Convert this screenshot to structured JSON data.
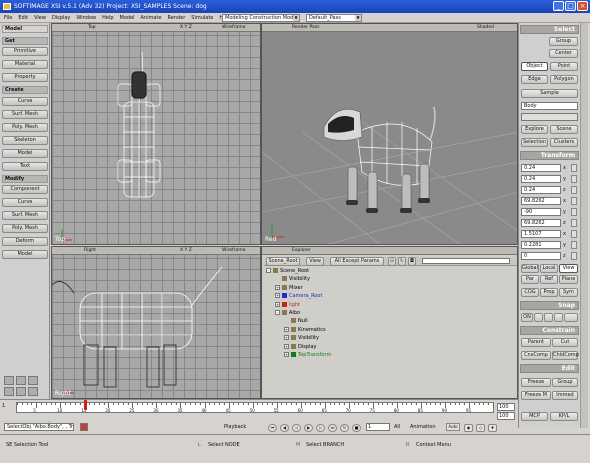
{
  "window": {
    "title": "SOFTIMAGE XSI v.5.1 (Adv 32) Project: XSI_SAMPLES  Scene: dog",
    "buttons": [
      "_",
      "□",
      "×"
    ]
  },
  "menubar": {
    "items": [
      "File",
      "Edit",
      "View",
      "Display",
      "Window",
      "Help",
      "Model",
      "Animate",
      "Render",
      "Simulate",
      "Hair"
    ],
    "mode_combo": "Modeling Construction Mode",
    "pass_combo": "Default_Pass"
  },
  "left_panel": {
    "model_label": "Model",
    "get_header": "Get",
    "get_buttons": [
      "Primitive",
      "Material",
      "Property"
    ],
    "create_header": "Create",
    "create_buttons": [
      "Curve",
      "Surf. Mesh",
      "Poly. Mesh",
      "Skeleton",
      "Model",
      "Text"
    ],
    "modify_header": "Modify",
    "modify_buttons": [
      "Component",
      "Curve",
      "Surf. Mesh",
      "Poly. Mesh",
      "Deform",
      "Model"
    ]
  },
  "viewports": {
    "top": {
      "name": "Top",
      "axes": "X Y Z",
      "mode": "Wireframe",
      "corner": "Top"
    },
    "render": {
      "name": "Render Pass",
      "mode": "Shaded",
      "corner": "Red"
    },
    "right": {
      "name": "Right",
      "axes": "X Y Z",
      "mode": "Wireframe",
      "corner": "Right"
    }
  },
  "explorer": {
    "title": "Explorer",
    "scope_button": "Scene_Root",
    "view_button": "View",
    "filter_button": "All Except Params",
    "tree": [
      {
        "label": "Scene_Root",
        "expand": "-",
        "color": "#000000",
        "level": 0
      },
      {
        "label": "Visibility",
        "expand": "",
        "color": "#000000",
        "level": 1
      },
      {
        "label": "Mixer",
        "expand": "+",
        "color": "#000000",
        "level": 1
      },
      {
        "label": "Camera_Root",
        "expand": "+",
        "color": "#1d2fc8",
        "level": 1
      },
      {
        "label": "light",
        "expand": "+",
        "color": "#c82020",
        "level": 1
      },
      {
        "label": "Aibo",
        "expand": "-",
        "color": "#000000",
        "level": 1
      },
      {
        "label": "Null",
        "expand": "",
        "color": "#000000",
        "level": 2
      },
      {
        "label": "Kinematics",
        "expand": "+",
        "color": "#000000",
        "level": 2
      },
      {
        "label": "Visibility",
        "expand": "+",
        "color": "#000000",
        "level": 2
      },
      {
        "label": "Display",
        "expand": "+",
        "color": "#000000",
        "level": 2
      },
      {
        "label": "TopTransform",
        "expand": "+",
        "color": "#1a7a1a",
        "level": 2
      }
    ]
  },
  "right_panel": {
    "select_header": "Select",
    "select_buttons": [
      "Group",
      "Center",
      "Object",
      "Point",
      "Edge",
      "Polygon",
      "Sample"
    ],
    "selected_object": "Body",
    "explore_button": "Explore",
    "scene_button": "Scene",
    "selection_button": "Selection",
    "clusters_button": "Clusters",
    "transform_header": "Transform",
    "scale": {
      "x": "0.24",
      "y": "0.24",
      "z": "0.24"
    },
    "rotation": {
      "x": "69.8262",
      "y": "-90",
      "z": "69.8262"
    },
    "translation": {
      "x": "1.5107",
      "y": "0.2281",
      "z": "0"
    },
    "axis_labels": [
      "x",
      "y",
      "z"
    ],
    "ref_buttons": [
      "Global",
      "Local",
      "View",
      "Par",
      "Ref",
      "Plane"
    ],
    "cog_buttons": [
      "COG",
      "Prop",
      "Sym"
    ],
    "snap_header": "Snap",
    "snap_on": "ON",
    "constrain_header": "Constrain",
    "constrain_buttons": [
      "Parent",
      "Cut",
      "CnsComp",
      "ChldComp"
    ],
    "edit_header": "Edit",
    "edit_buttons": [
      "Freeze",
      "Group",
      "Freeze M",
      "Immed"
    ],
    "mcp_labels": [
      "MCP",
      "KP/L"
    ]
  },
  "timeline": {
    "start_frame": "1",
    "end_frame": "100",
    "total_frames": "100",
    "ruler_labels": [
      "5",
      "10",
      "15",
      "20",
      "25",
      "30",
      "35",
      "40",
      "45",
      "50",
      "55",
      "60",
      "65",
      "70",
      "75",
      "80",
      "85",
      "90",
      "95"
    ],
    "playhead_frame": 15,
    "playback_label": "Playback",
    "animation_label": "Animation",
    "auto_label": "Auto",
    "all_label": "All",
    "current_frame": "1"
  },
  "bottom": {
    "command_line": "SelectObj \"Aibo.Body\", , True",
    "status_tool": "SE Selection Tool",
    "mouse_left": "Select NODE",
    "mouse_mid": "Select BRANCH",
    "mouse_right": "Context Menu"
  },
  "colors": {
    "titlebar": "#2a5ed8",
    "panel": "#cfcfcf",
    "grid": "#a8a8a8",
    "wire": "#ffffff",
    "render_bg": "#8a8a8a"
  }
}
